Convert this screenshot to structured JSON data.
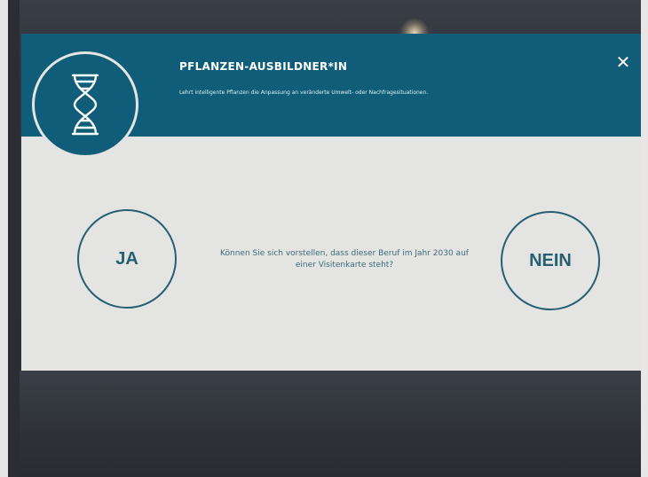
{
  "dialog": {
    "title": "PFLANZEN-AUSBILDNER*IN",
    "subtitle": "Lehrt intelligente Pflanzen die Anpassung an veränderte Umwelt- oder Nachfragesituationen.",
    "close_label": "✕",
    "icon": "dna-icon",
    "question": "Können Sie sich vorstellen, dass dieser Beruf im Jahr 2030 auf einer Visitenkarte steht?",
    "yes_label": "JA",
    "no_label": "NEIN"
  },
  "colors": {
    "header": "#0f5d78",
    "body": "#e4e4e2",
    "accent": "#275f72"
  }
}
